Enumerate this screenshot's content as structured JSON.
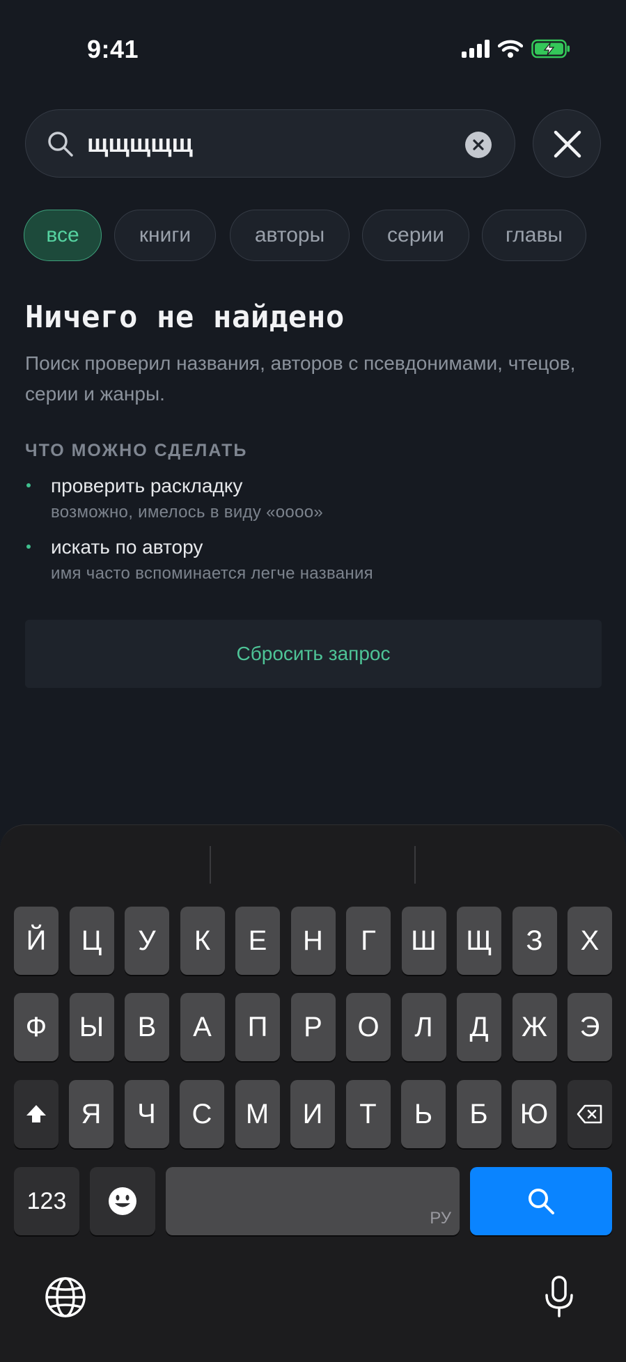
{
  "status_bar": {
    "time": "9:41"
  },
  "search": {
    "query": "щщщщщ"
  },
  "filters": [
    {
      "label": "все",
      "active": true
    },
    {
      "label": "книги",
      "active": false
    },
    {
      "label": "авторы",
      "active": false
    },
    {
      "label": "серии",
      "active": false
    },
    {
      "label": "главы",
      "active": false
    }
  ],
  "empty_state": {
    "title": "Ничего не найдено",
    "description": "Поиск проверил названия, авторов с псевдонимами, чтецов, серии и жанры.",
    "section_title": "ЧТО МОЖНО СДЕЛАТЬ",
    "tips": [
      {
        "title": "проверить раскладку",
        "subtitle": "возможно, имелось в виду «oooo»"
      },
      {
        "title": "искать по автору",
        "subtitle": "имя часто вспоминается легче названия"
      }
    ],
    "reset_label": "Сбросить запрос"
  },
  "keyboard": {
    "row1": [
      "Й",
      "Ц",
      "У",
      "К",
      "Е",
      "Н",
      "Г",
      "Ш",
      "Щ",
      "З",
      "Х"
    ],
    "row2": [
      "Ф",
      "Ы",
      "В",
      "А",
      "П",
      "Р",
      "О",
      "Л",
      "Д",
      "Ж",
      "Э"
    ],
    "row3": [
      "Я",
      "Ч",
      "С",
      "М",
      "И",
      "Т",
      "Ь",
      "Б",
      "Ю"
    ],
    "numbers_label": "123",
    "space_language": "РУ"
  },
  "colors": {
    "background": "#161a21",
    "accent_green": "#4ec497",
    "keyboard_blue": "#0a84ff"
  }
}
